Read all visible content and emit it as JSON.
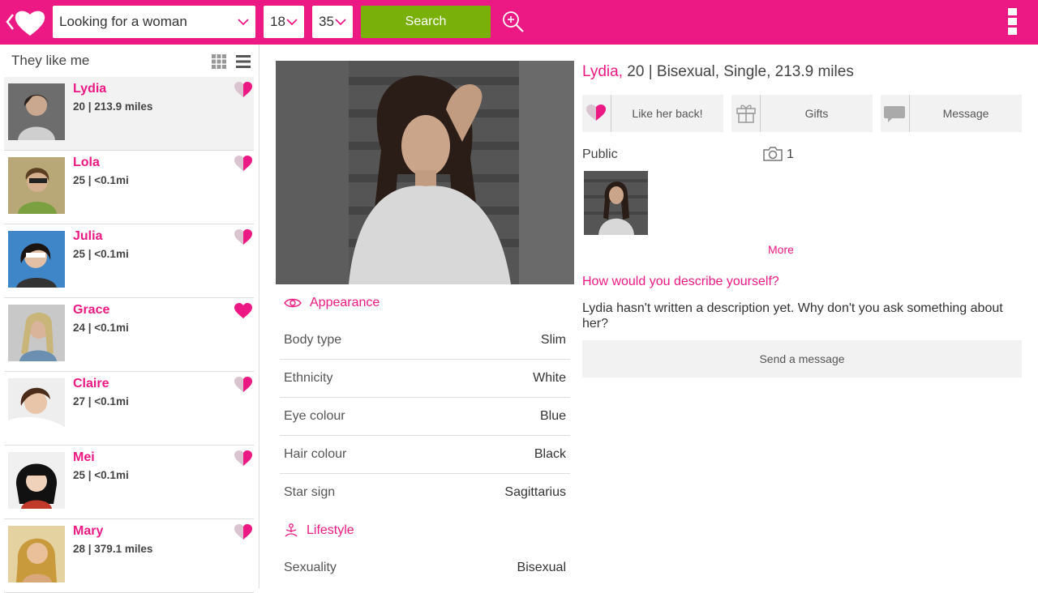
{
  "colors": {
    "brand": "#ec1984",
    "search_green": "#79b10a"
  },
  "topbar": {
    "looking_for": "Looking for a woman",
    "age_min": "18",
    "age_max": "35",
    "search_label": "Search",
    "icons": [
      "back-arrow-icon",
      "heart-logo-icon",
      "zoom-search-icon",
      "overflow-menu-icon"
    ]
  },
  "sidebar": {
    "title": "They like me",
    "people": [
      {
        "name": "Lydia",
        "meta": "20 | 213.9 miles",
        "heart": "half"
      },
      {
        "name": "Lola",
        "meta": "25 | <0.1mi",
        "heart": "half"
      },
      {
        "name": "Julia",
        "meta": "25 | <0.1mi",
        "heart": "half"
      },
      {
        "name": "Grace",
        "meta": "24 | <0.1mi",
        "heart": "full"
      },
      {
        "name": "Claire",
        "meta": "27 | <0.1mi",
        "heart": "half"
      },
      {
        "name": "Mei",
        "meta": "25 | <0.1mi",
        "heart": "half"
      },
      {
        "name": "Mary",
        "meta": "28 | 379.1 miles",
        "heart": "half"
      }
    ]
  },
  "profile": {
    "name": "Lydia,",
    "summary": " 20 | Bisexual, Single, 213.9 miles",
    "actions": {
      "like_back": "Like her back!",
      "gifts": "Gifts",
      "message": "Message"
    },
    "public_label": "Public",
    "photo_count": "1",
    "more_label": "More",
    "describe_question": "How would you describe yourself?",
    "describe_answer": "Lydia hasn't written a description yet. Why don't you ask something about her?",
    "send_message": "Send a message"
  },
  "appearance": {
    "title": "Appearance",
    "rows": [
      {
        "k": "Body type",
        "v": "Slim"
      },
      {
        "k": "Ethnicity",
        "v": "White"
      },
      {
        "k": "Eye colour",
        "v": "Blue"
      },
      {
        "k": "Hair colour",
        "v": "Black"
      },
      {
        "k": "Star sign",
        "v": "Sagittarius"
      }
    ]
  },
  "lifestyle": {
    "title": "Lifestyle",
    "rows": [
      {
        "k": "Sexuality",
        "v": "Bisexual"
      }
    ]
  }
}
